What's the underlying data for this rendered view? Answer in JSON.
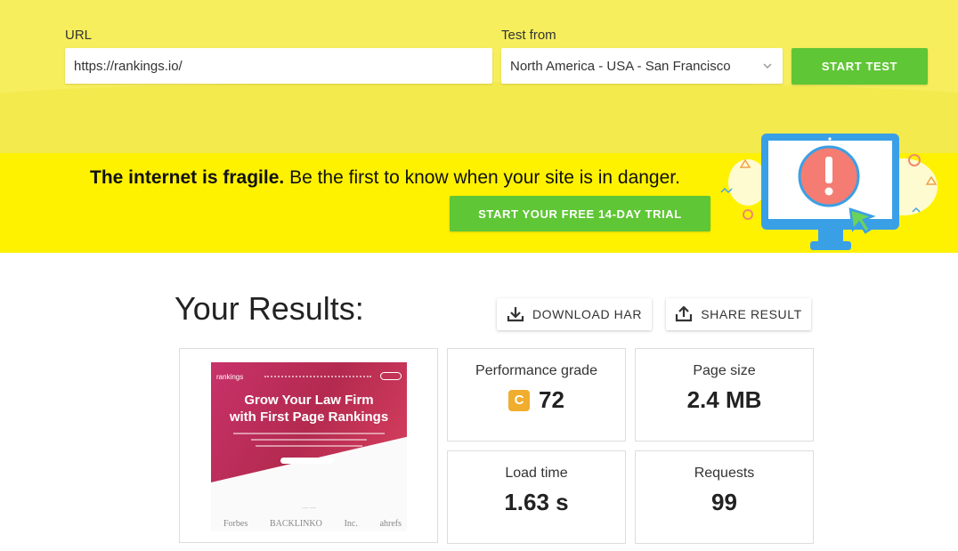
{
  "form": {
    "url_label": "URL",
    "url_value": "https://rankings.io/",
    "test_from_label": "Test from",
    "test_from_value": "North America - USA - San Francisco",
    "start_test_label": "START TEST"
  },
  "banner": {
    "bold": "The internet is fragile.",
    "rest": "Be the first to know when your site is in danger.",
    "cta_label": "START YOUR FREE 14-DAY TRIAL"
  },
  "results": {
    "title": "Your Results:",
    "download_har_label": "DOWNLOAD HAR",
    "share_result_label": "SHARE RESULT"
  },
  "screenshot": {
    "logo": "rankings",
    "headline_1": "Grow Your Law Firm",
    "headline_2": "with First Page Rankings",
    "brands": [
      "Forbes",
      "BACKLINKO",
      "Inc.",
      "ahrefs"
    ]
  },
  "metrics": {
    "performance_label": "Performance grade",
    "performance_grade": "C",
    "performance_value": "72",
    "page_size_label": "Page size",
    "page_size_value": "2.4 MB",
    "load_time_label": "Load time",
    "load_time_value": "1.63 s",
    "requests_label": "Requests",
    "requests_value": "99"
  },
  "colors": {
    "green": "#5fc636",
    "yellow_banner": "#fff200",
    "grade_c": "#f0ad2e"
  }
}
